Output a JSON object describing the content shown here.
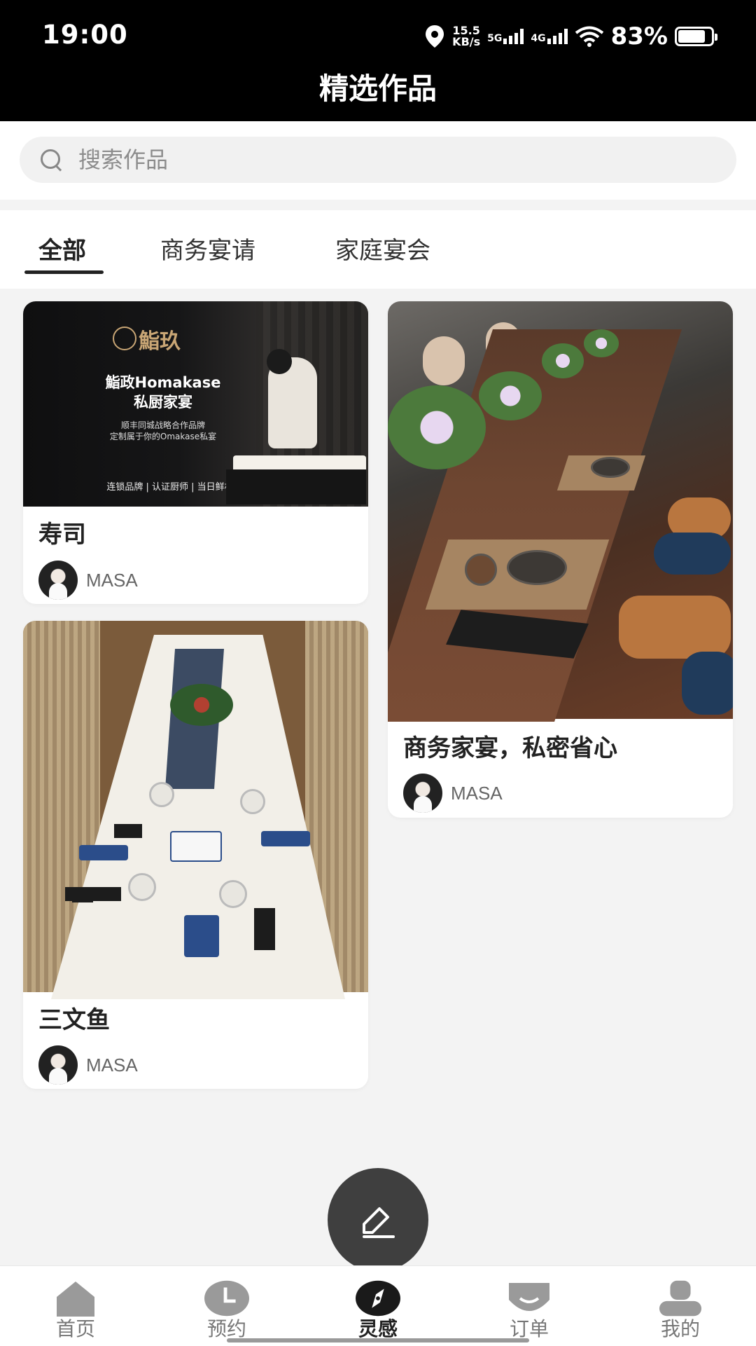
{
  "status_bar": {
    "time": "19:00",
    "speed_value": "15.5",
    "speed_unit": "KB/s",
    "net1": "5G",
    "net2": "4G",
    "battery": "83%"
  },
  "header": {
    "title": "精选作品"
  },
  "search": {
    "placeholder": "搜索作品"
  },
  "tabs": [
    {
      "label": "全部",
      "active": true
    },
    {
      "label": "商务宴请",
      "active": false
    },
    {
      "label": "家庭宴会",
      "active": false
    }
  ],
  "cards": [
    {
      "title": "寿司",
      "author": "MASA",
      "image_text": {
        "logo": "鮨玖",
        "line1": "鮨政Homakase",
        "line2": "私厨家宴",
        "line3": "顺丰同城战略合作品牌",
        "line4": "定制属于你的Omakase私宴",
        "line5": "连锁品牌 | 认证厨师 | 当日鲜材"
      }
    },
    {
      "title": "商务家宴，私密省心",
      "author": "MASA"
    },
    {
      "title": "三文鱼",
      "author": "MASA"
    }
  ],
  "bottom_nav": [
    {
      "label": "首页",
      "icon": "home-icon",
      "active": false
    },
    {
      "label": "预约",
      "icon": "clock-icon",
      "active": false
    },
    {
      "label": "灵感",
      "icon": "compass-icon",
      "active": true
    },
    {
      "label": "订单",
      "icon": "order-icon",
      "active": false
    },
    {
      "label": "我的",
      "icon": "profile-icon",
      "active": false
    }
  ],
  "colors": {
    "accent": "#222222",
    "fab": "#3f3f3f",
    "header_bg": "#000000"
  }
}
